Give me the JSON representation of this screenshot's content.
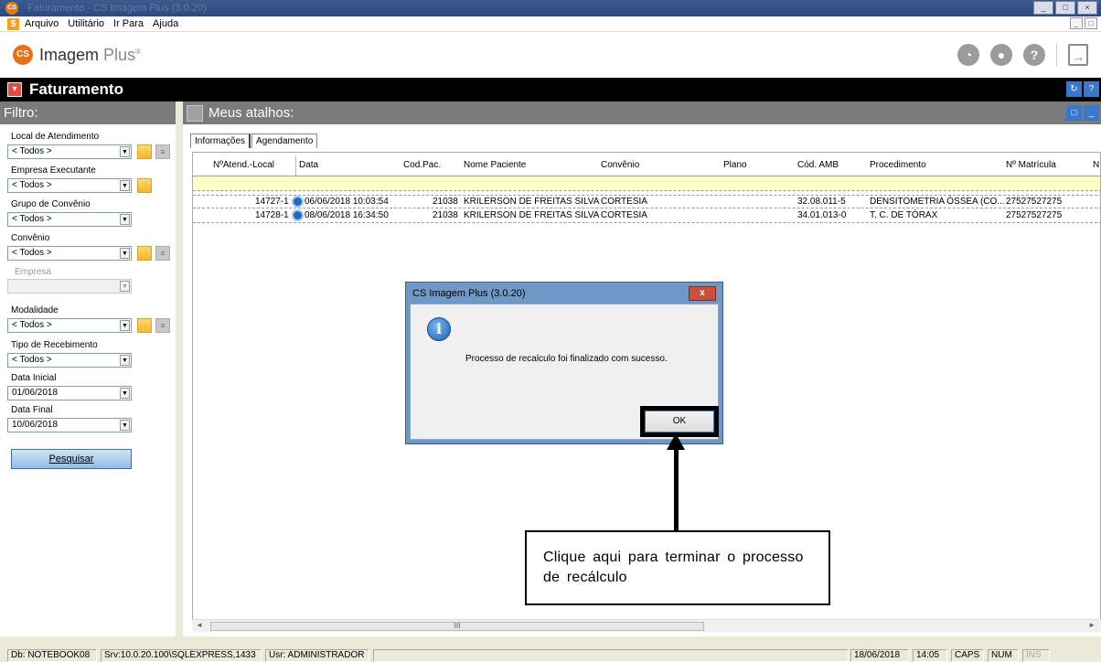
{
  "window": {
    "title": "Faturamento - CS Imagem Plus (3.0.20)",
    "buttons": [
      "_",
      "□",
      "×"
    ]
  },
  "menu": {
    "items": [
      "Arquivo",
      "Utilitário",
      "Ir Para",
      "Ajuda"
    ]
  },
  "logo": {
    "name": "Imagem",
    "suffix": "Plus",
    "mark": "®"
  },
  "module": {
    "title": "Faturamento"
  },
  "filter": {
    "title": "Filtro:",
    "local_label": "Local de Atendimento",
    "local_value": "< Todos >",
    "empresa_label": "Empresa Executante",
    "empresa_value": "< Todos >",
    "grupo_label": "Grupo de Convênio",
    "grupo_value": "< Todos >",
    "convenio_label": "Convênio",
    "convenio_value": "< Todos >",
    "empresa2_label": "Empresa",
    "empresa2_value": "",
    "modalidade_label": "Modalidade",
    "modalidade_value": "< Todos >",
    "tipo_label": "Tipo de Recebimento",
    "tipo_value": "< Todos >",
    "data_inicial_label": "Data Inicial",
    "data_inicial_value": "01/06/2018",
    "data_final_label": "Data Final",
    "data_final_value": "10/06/2018",
    "search_button": "Pesquisar"
  },
  "main": {
    "title": "Meus atalhos:",
    "tabs": [
      "Informações",
      "Agendamento"
    ],
    "columns": [
      "NºAtend.-Local",
      "Data",
      "Cod.Pac.",
      "Nome Paciente",
      "Convênio",
      "Plano",
      "Cód. AMB",
      "Procedimento",
      "Nº Matrícula",
      "N"
    ],
    "rows": [
      {
        "atend": "14727-1",
        "data": "06/06/2018 10:03:54",
        "codpac": "21038",
        "nome": "KRILERSON DE FREITAS SILVA",
        "convenio": "CORTESIA",
        "plano": "",
        "amb": "32.08.011-5",
        "procedimento": "DENSITOMETRIA ÓSSEA (CO...",
        "matricula": "27527527275"
      },
      {
        "atend": "14728-1",
        "data": "08/06/2018 16:34:50",
        "codpac": "21038",
        "nome": "KRILERSON DE FREITAS SILVA",
        "convenio": "CORTESIA",
        "plano": "",
        "amb": "34.01.013-0",
        "procedimento": "T. C. DE TÓRAX",
        "matricula": "27527527275"
      }
    ],
    "scroll_thumb": "III"
  },
  "dialog": {
    "title": "CS Imagem Plus (3.0.20)",
    "close": "x",
    "message": "Processo de recalculo foi finalizado com sucesso.",
    "ok_button": "OK"
  },
  "callout": {
    "text": "Clique aqui para terminar o processo de recálculo"
  },
  "statusbar": {
    "db": "Db: NOTEBOOK08",
    "srv": "Srv:10.0.20.100\\SQLEXPRESS,1433",
    "usr": "Usr: ADMINISTRADOR",
    "date": "18/06/2018",
    "time": "14:05",
    "caps": "CAPS",
    "num": "NUM",
    "ins": "INS"
  }
}
